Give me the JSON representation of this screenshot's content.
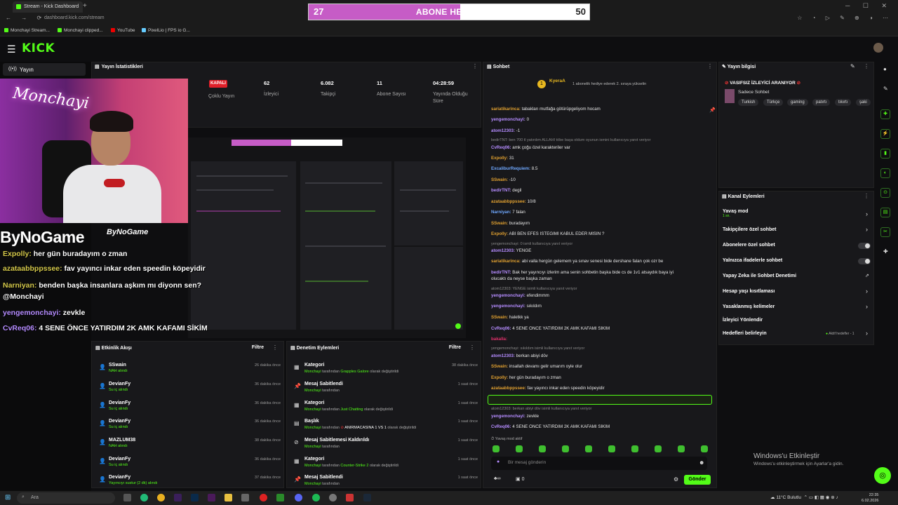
{
  "browser": {
    "tab_title": "Stream - Kick Dashboard",
    "url": "dashboard.kick.com/stream",
    "bookmarks": [
      "Monchayi Stream...",
      "Monchayi clipped...",
      "YouTube",
      "PixelLio | FPS io G..."
    ]
  },
  "goal_overlay": {
    "current": "27",
    "title": "ABONE HEDEFI",
    "target": "50",
    "progress": 0.54
  },
  "header": {
    "logo": "KICK"
  },
  "sidebar": {
    "items": [
      {
        "label": "Yayın"
      }
    ]
  },
  "stats": {
    "title": "Yayın İstatistikleri",
    "status_badge": "KAPALI",
    "items": [
      {
        "label": "Çoklu Yayın",
        "value": ""
      },
      {
        "label": "İzleyici",
        "value": "62"
      },
      {
        "label": "Takipçi",
        "value": "6.082"
      },
      {
        "label": "Abone Sayısı",
        "value": "11"
      },
      {
        "label": "Yayında Olduğu Süre",
        "value": "04:28:59"
      }
    ]
  },
  "overlay": {
    "brand": "ByNoGame",
    "brand_small": "ByNoGame",
    "messages": [
      {
        "user": "Expolly:",
        "text": "her gün buradayım o zman"
      },
      {
        "user": "azataabbppssee:",
        "text": "fav yayıncı inkar eden speedin köpeyidir"
      },
      {
        "user": "Narniyan:",
        "text": "benden başka insanlara aşkım mı diyonn sen?"
      },
      {
        "user": "",
        "text": "@Monchayi"
      },
      {
        "user": "yengemonchayi:",
        "text": "zevkle"
      },
      {
        "user": "CvReq06:",
        "text": "4 SENE ÖNCE YATIRDIM 2K AMK KAFAMI SİKİM"
      }
    ]
  },
  "activity": {
    "title": "Etkinlik Akışı",
    "filter": "Filtre",
    "rows": [
      {
        "name": "SSwain",
        "event": "NAH alındı",
        "time": "26 dakika önce"
      },
      {
        "name": "DevianFy",
        "event": "Su iç alındı",
        "time": "36 dakika önce"
      },
      {
        "name": "DevianFy",
        "event": "Su iç alındı",
        "time": "36 dakika önce"
      },
      {
        "name": "DevianFy",
        "event": "Su iç alındı",
        "time": "36 dakika önce"
      },
      {
        "name": "MAZLUM38",
        "event": "NAH alındı",
        "time": "38 dakika önce"
      },
      {
        "name": "DevianFy",
        "event": "Su iç alındı",
        "time": "36 dakika önce"
      },
      {
        "name": "DevianFy",
        "event": "Yayıncıyı sustur (2 dk) alındı",
        "time": "37 dakika önce"
      }
    ]
  },
  "moderation": {
    "title": "Denetim Eylemleri",
    "filter": "Filtre",
    "rows": [
      {
        "name": "Kategori",
        "by": "Monchayi",
        "mid": "tarafından",
        "value": "Grapples Galore",
        "rest": "olarak değiştirildi",
        "time": "38 dakika önce"
      },
      {
        "name": "Mesaj Sabitlendi",
        "by": "Monchayi",
        "mid": "tarafından",
        "value": "",
        "rest": "",
        "time": "1 saat önce"
      },
      {
        "name": "Kategori",
        "by": "Monchayi",
        "mid": "tarafından",
        "value": "Just Chatting",
        "rest": "olarak değiştirildi",
        "time": "1 saat önce"
      },
      {
        "name": "Başlık",
        "by": "Monchayi",
        "mid": "tarafından",
        "value": "ANIRMACASINA 1 VS 1",
        "rest": "olarak değiştirildi",
        "time": "1 saat önce"
      },
      {
        "name": "Mesaj Sabitlemesi Kaldırıldı",
        "by": "Monchayi",
        "mid": "tarafından",
        "value": "",
        "rest": "",
        "time": "1 saat önce"
      },
      {
        "name": "Kategori",
        "by": "Monchayi",
        "mid": "tarafından",
        "value": "Counter-Strike 2",
        "rest": "olarak değiştirildi",
        "time": "1 saat önce"
      },
      {
        "name": "Mesaj Sabitlendi",
        "by": "Monchayi",
        "mid": "tarafından",
        "value": "",
        "rest": "",
        "time": "1 saat önce"
      }
    ]
  },
  "chat": {
    "title": "Sohbet",
    "pinned_user": "KyeraA",
    "pinned_text": "1 abonelik hediye ederek 2. sıraya yükselin",
    "messages": [
      {
        "user": "sariatikarinca:",
        "text": "tabakları mutfağa götürüpgeliyom hocam",
        "color": "#e0a030",
        "reply": false
      },
      {
        "user": "yengemonchayi:",
        "text": "0",
        "color": "#b58cff",
        "reply": false
      },
      {
        "user": "atom12303:",
        "text": "-1",
        "color": "#b58cff",
        "reply": false
      },
      {
        "user": "",
        "text": "bedirTNT: ben 700 tl yatırdım ALLAHI töbe başa oldum oyunun ismini kullanıcıya yanıt veriyor",
        "color": "#888",
        "reply": true
      },
      {
        "user": "CvReq06:",
        "text": "amk çoğu özel karakteriler var",
        "color": "#b58cff",
        "reply": false
      },
      {
        "user": "Expolly:",
        "text": "31",
        "color": "#e0a030",
        "reply": false
      },
      {
        "user": "ExcaliburRequiem:",
        "text": "8.5",
        "color": "#6fa8ff",
        "reply": false
      },
      {
        "user": "SSwain:",
        "text": "-10",
        "color": "#e0a030",
        "reply": false
      },
      {
        "user": "bedirTNT:",
        "text": "degil",
        "color": "#b58cff",
        "reply": false
      },
      {
        "user": "azataabbppssee:",
        "text": "10/8",
        "color": "#e0a030",
        "reply": false
      },
      {
        "user": "Narniyan:",
        "text": "7 falan",
        "color": "#6fa8ff",
        "reply": false
      },
      {
        "user": "SSwain:",
        "text": "buradayım",
        "color": "#e0a030",
        "reply": false
      },
      {
        "user": "Expolly:",
        "text": "ABİ BEN EFES İSTEĞİMİ KABUL EDER MİSİN ?",
        "color": "#e0a030",
        "reply": false
      },
      {
        "user": "",
        "text": "yengemonchayi: 0 ismli kullanıcıya yanıt veriyor",
        "color": "#888",
        "reply": true
      },
      {
        "user": "atom12303:",
        "text": "YENGE",
        "color": "#b58cff",
        "reply": false
      },
      {
        "user": "sariatikarinca:",
        "text": "abi valla hergün gelemem ya sınav senesi bide dershane falan çok ozr be",
        "color": "#e0a030",
        "reply": false
      },
      {
        "user": "bedirTNT:",
        "text": "Bak her yayıncıyı izlerim ama senin sohbetin başka bide cs de 1v1 atsaydık baya iyi",
        "color": "#b58cff",
        "reply": false
      },
      {
        "user": "",
        "text": "olucaktı da neyse başka zaman",
        "color": "#e6e6e6",
        "reply": false
      },
      {
        "user": "",
        "text": "atom12303: YENGE isimli kullanıcıya yanıt veriyor",
        "color": "#888",
        "reply": true
      },
      {
        "user": "yengemonchayi:",
        "text": "efendimmm",
        "color": "#b58cff",
        "reply": false
      },
      {
        "user": "yengemonchayi:",
        "text": "sıkıldım",
        "color": "#b58cff",
        "reply": false
      },
      {
        "user": "SSwain:",
        "text": "haletkk ya",
        "color": "#e0a030",
        "reply": false
      },
      {
        "user": "CvReq06:",
        "text": "4 SENE ÖNCE YATIRDIM 2K AMK KAFAMI SİKİM",
        "color": "#b58cff",
        "reply": false
      },
      {
        "user": "bakalla:",
        "text": "",
        "color": "#e0306a",
        "reply": false
      },
      {
        "user": "",
        "text": "yengemonchayi: sıkıldım isimli kullanıcıya yanıt veriyor",
        "color": "#888",
        "reply": true
      },
      {
        "user": "atom12303:",
        "text": "berkan abiyi döv",
        "color": "#b58cff",
        "reply": false
      },
      {
        "user": "SSwain:",
        "text": "insallah devamı gelir umarım oyle olur",
        "color": "#e0a030",
        "reply": false
      },
      {
        "user": "Expolly:",
        "text": "her gün buradayım o zman",
        "color": "#e0a030",
        "reply": false
      },
      {
        "user": "azataabbppssee:",
        "text": "fav yayıncı inkar eden speedin köpeyidir",
        "color": "#e0a030",
        "reply": false
      },
      {
        "user": "Narniyan:",
        "text": "benden başka insanlara aşkım mı diyonn sen? @Monchayi",
        "color": "#e0a030",
        "reply": false
      },
      {
        "user": "",
        "text": "atom12303: berkan abiyi döv isimli kullanıcıya yanıt veriyor",
        "color": "#888",
        "reply": true
      },
      {
        "user": "yengemonchayi:",
        "text": "zevkle",
        "color": "#b58cff",
        "reply": false
      },
      {
        "user": "CvReq06:",
        "text": "4 SENE ÖNCE YATIRDIM 2K AMK KAFAMI SİKİM",
        "color": "#b58cff",
        "reply": false
      }
    ],
    "slow_mode": "Yavaş mod aktif",
    "input_placeholder": "Bir mesaj gönderin",
    "count": "0",
    "send": "Gönder"
  },
  "info": {
    "title": "Yayın bilgisi",
    "stream_title": "VASIFSIZ İZLEYİCİ ARANIYOR",
    "category": "Sadece Sohbet",
    "tags": [
      "Turkish",
      "Türkçe",
      "gaming",
      "patırtı",
      "tıkırtı",
      "şaki"
    ]
  },
  "channel_actions": {
    "title": "Kanal Eylemleri",
    "items": [
      {
        "label": "Yavaş mod",
        "sub": "1 sn."
      },
      {
        "label": "Takipçilere özel sohbet",
        "sub": ""
      },
      {
        "label": "Abonelere özel sohbet",
        "sub": ""
      },
      {
        "label": "Yalnızca ifadelerle sohbet",
        "sub": ""
      },
      {
        "label": "Yapay Zeka ile Sohbet Denetimi",
        "sub": ""
      },
      {
        "label": "Hesap yaşı kısıtlaması",
        "sub": ""
      },
      {
        "label": "Yasaklanmış kelimeler",
        "sub": ""
      },
      {
        "label": "İzleyici Yönlendir",
        "sub": ""
      },
      {
        "label": "Hedefleri belirleyin",
        "sub": ""
      }
    ],
    "goal_status": "Aktif hedefler - 1"
  },
  "windows": {
    "activate_title": "Windows'u Etkinleştir",
    "activate_sub": "Windows'u etkinleştirmek için Ayarlar'a gidin.",
    "search": "Ara",
    "weather": "11°C  Bulutlu",
    "time": "22:35",
    "date": "6.02.2026"
  }
}
